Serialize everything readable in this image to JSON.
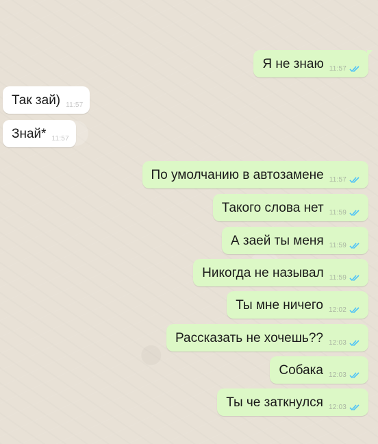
{
  "colors": {
    "incoming_bubble": "#ffffff",
    "outgoing_bubble": "#dcf8c6",
    "read_ticks": "#4fc3f7",
    "wallpaper": "#e8e1d6"
  },
  "messages": [
    {
      "direction": "out",
      "text": "Я не знаю",
      "time": "11:57",
      "status": "read-ticks-icon"
    },
    {
      "direction": "in",
      "text": "Так зай)",
      "time": "11:57"
    },
    {
      "direction": "in",
      "text": "Знай*",
      "time": "11:57"
    },
    {
      "direction": "out",
      "text": "По умолчанию в автозамене",
      "time": "11:57",
      "status": "read-ticks-icon"
    },
    {
      "direction": "out",
      "text": "Такого слова нет",
      "time": "11:59",
      "status": "read-ticks-icon"
    },
    {
      "direction": "out",
      "text": "А заей ты меня",
      "time": "11:59",
      "status": "read-ticks-icon"
    },
    {
      "direction": "out",
      "text": "Никогда не называл",
      "time": "11:59",
      "status": "read-ticks-icon"
    },
    {
      "direction": "out",
      "text": "Ты мне ничего",
      "time": "12:02",
      "status": "read-ticks-icon"
    },
    {
      "direction": "out",
      "text": "Рассказать не хочешь??",
      "time": "12:03",
      "status": "read-ticks-icon"
    },
    {
      "direction": "out",
      "text": "Собака",
      "time": "12:03",
      "status": "read-ticks-icon"
    },
    {
      "direction": "out",
      "text": "Ты че заткнулся",
      "time": "12:03",
      "status": "read-ticks-icon"
    }
  ]
}
